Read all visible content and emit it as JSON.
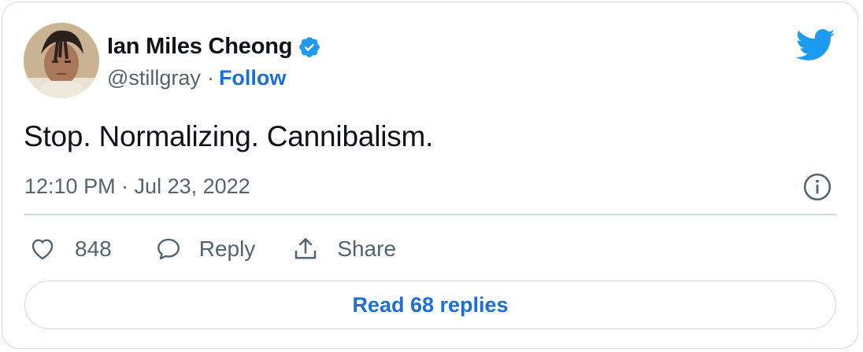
{
  "author": {
    "display_name": "Ian Miles Cheong",
    "handle": "@stillgray",
    "separator": "·",
    "follow_label": "Follow",
    "verified": true
  },
  "tweet": {
    "text": "Stop. Normalizing. Cannibalism.",
    "timestamp": "12:10 PM · Jul 23, 2022"
  },
  "actions": {
    "like_count": "848",
    "reply_label": "Reply",
    "share_label": "Share"
  },
  "read_replies_label": "Read 68 replies",
  "icons": {
    "logo": "twitter-bird-icon",
    "verified": "verified-badge-icon",
    "info": "info-icon",
    "like": "heart-icon",
    "reply": "speech-bubble-icon",
    "share": "share-upload-icon"
  },
  "colors": {
    "accent": "#1d9bf0",
    "link": "#1d6fd6",
    "text": "#0f1419",
    "muted": "#536471",
    "border": "#cfd9de"
  }
}
